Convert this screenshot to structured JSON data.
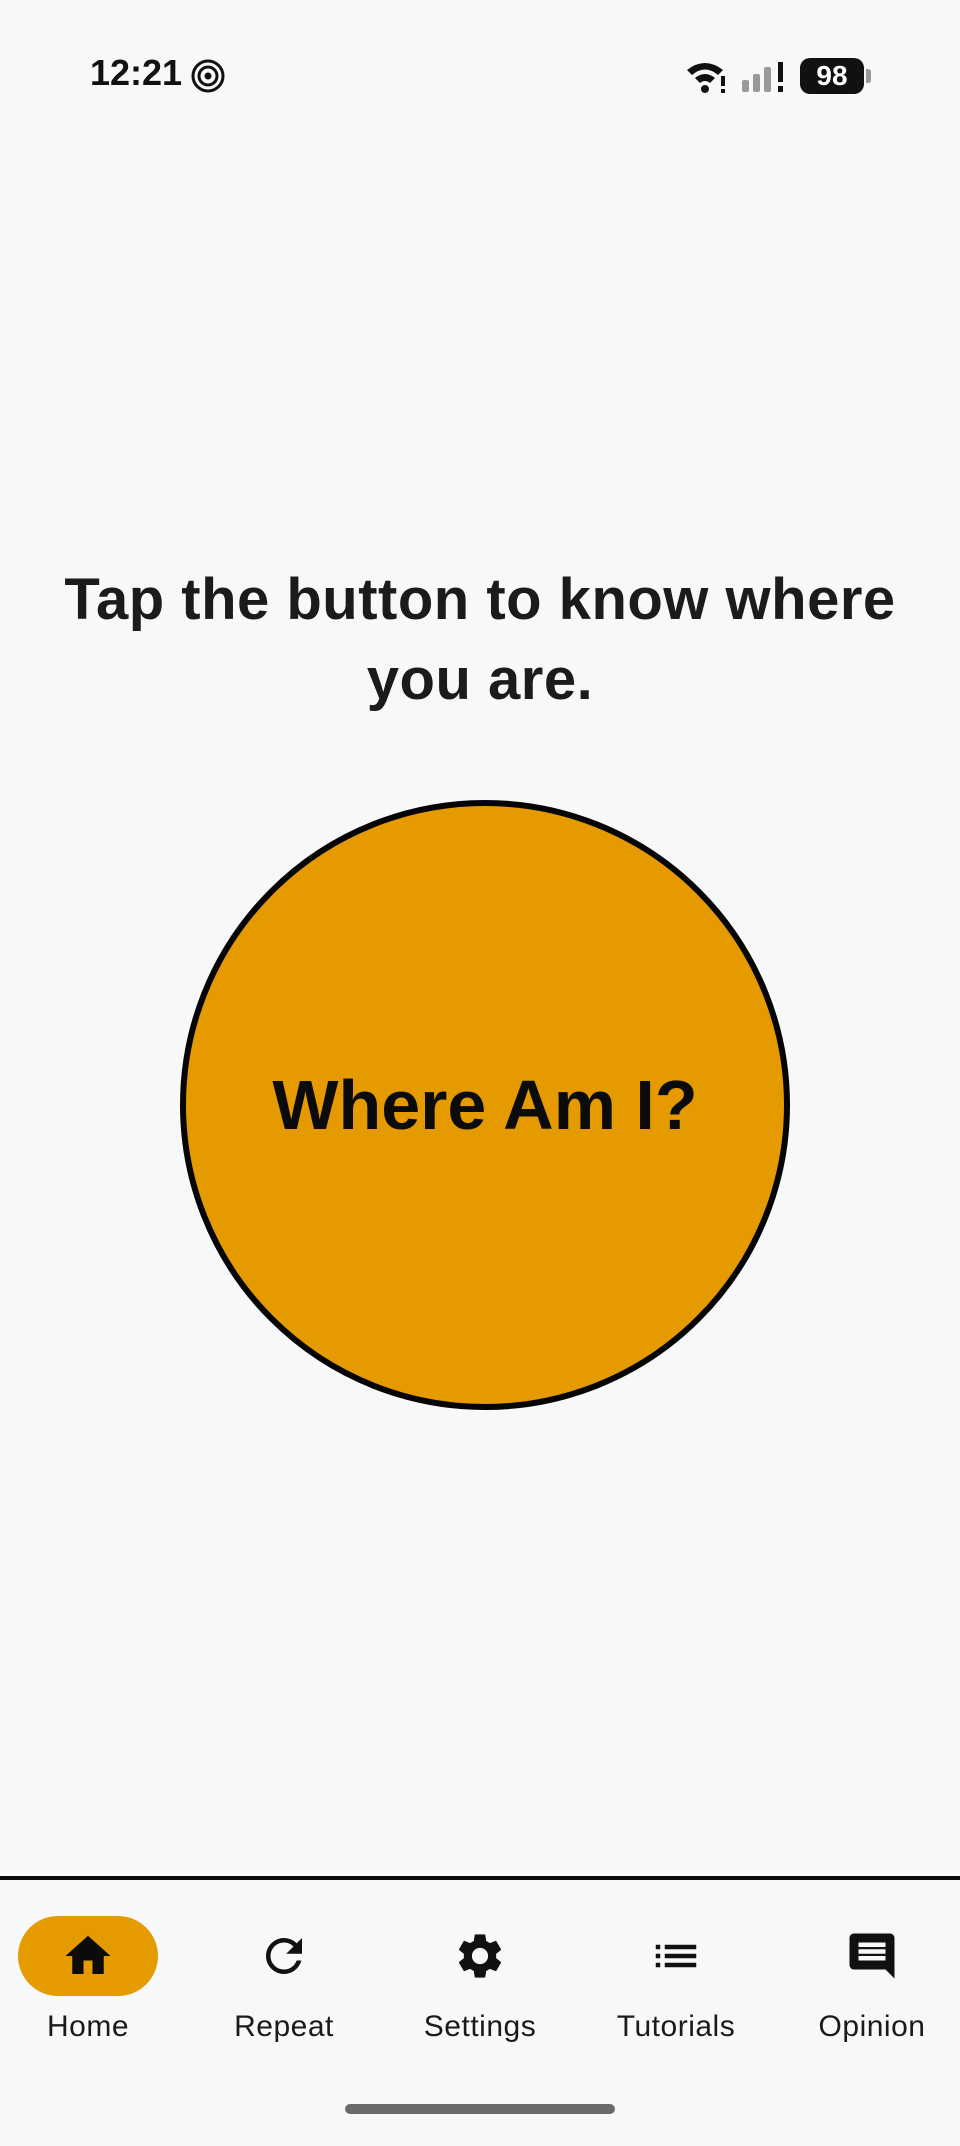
{
  "status_bar": {
    "time": "12:21",
    "battery": "98",
    "icons": [
      "spiral-notification-icon",
      "wifi-icon",
      "signal-icon",
      "battery-icon"
    ]
  },
  "main": {
    "prompt": "Tap the button to know where you are.",
    "button_label": "Where Am I?"
  },
  "bottom_nav": {
    "items": [
      {
        "label": "Home",
        "icon": "home-icon",
        "active": true
      },
      {
        "label": "Repeat",
        "icon": "refresh-icon",
        "active": false
      },
      {
        "label": "Settings",
        "icon": "gear-icon",
        "active": false
      },
      {
        "label": "Tutorials",
        "icon": "list-icon",
        "active": false
      },
      {
        "label": "Opinion",
        "icon": "chat-icon",
        "active": false
      }
    ]
  },
  "colors": {
    "accent": "#e59a00",
    "background": "#f7f8fa",
    "text": "#161616"
  }
}
